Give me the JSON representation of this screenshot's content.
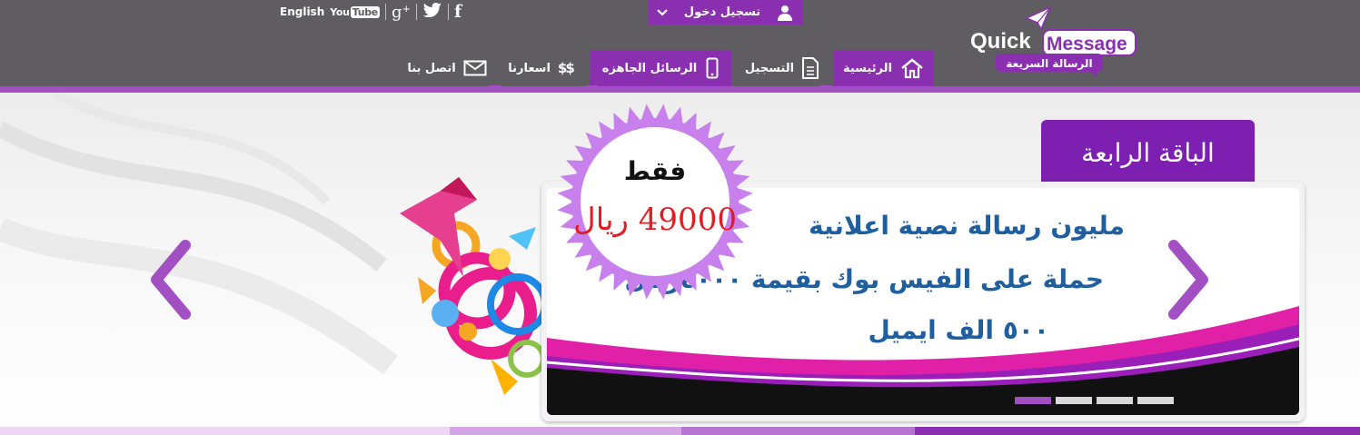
{
  "header": {
    "language_link": "English",
    "social": {
      "youtube_you": "You",
      "youtube_tube": "Tube",
      "gplus": "g⁺",
      "facebook": "f"
    },
    "login_label": "تسجيل دخول",
    "logo": {
      "top": "Quick",
      "box": "Message",
      "arabic": "الرسالة السريعة"
    },
    "nav": [
      {
        "label": "الرئيسية",
        "icon": "home-icon"
      },
      {
        "label": "التسجيل",
        "icon": "document-icon"
      },
      {
        "label": "الرسائل الجاهزه",
        "icon": "mobile-phone-icon"
      },
      {
        "label": "اسعارنا",
        "icon": "dollar-icon",
        "icon_text": "$$"
      },
      {
        "label": "اتصل بنا",
        "icon": "envelope-icon"
      }
    ]
  },
  "slider": {
    "tab_title": "الباقة الرابعة",
    "badge_top": "فقط",
    "badge_price": "49000 ريال",
    "lines": [
      "مليون رسالة نصية اعلانية",
      "حملة على الفيس بوك  بقيمة ٤٠٠٠ريال",
      "٥٠٠ الف ايميل"
    ],
    "active_dot": 0,
    "dot_count": 4
  },
  "colors": {
    "header_bg": "#5f5d61",
    "accent": "#8a2fb0",
    "strip": "#a24fc4",
    "text_blue": "#1f5fa0",
    "price_red": "#e31c23"
  }
}
